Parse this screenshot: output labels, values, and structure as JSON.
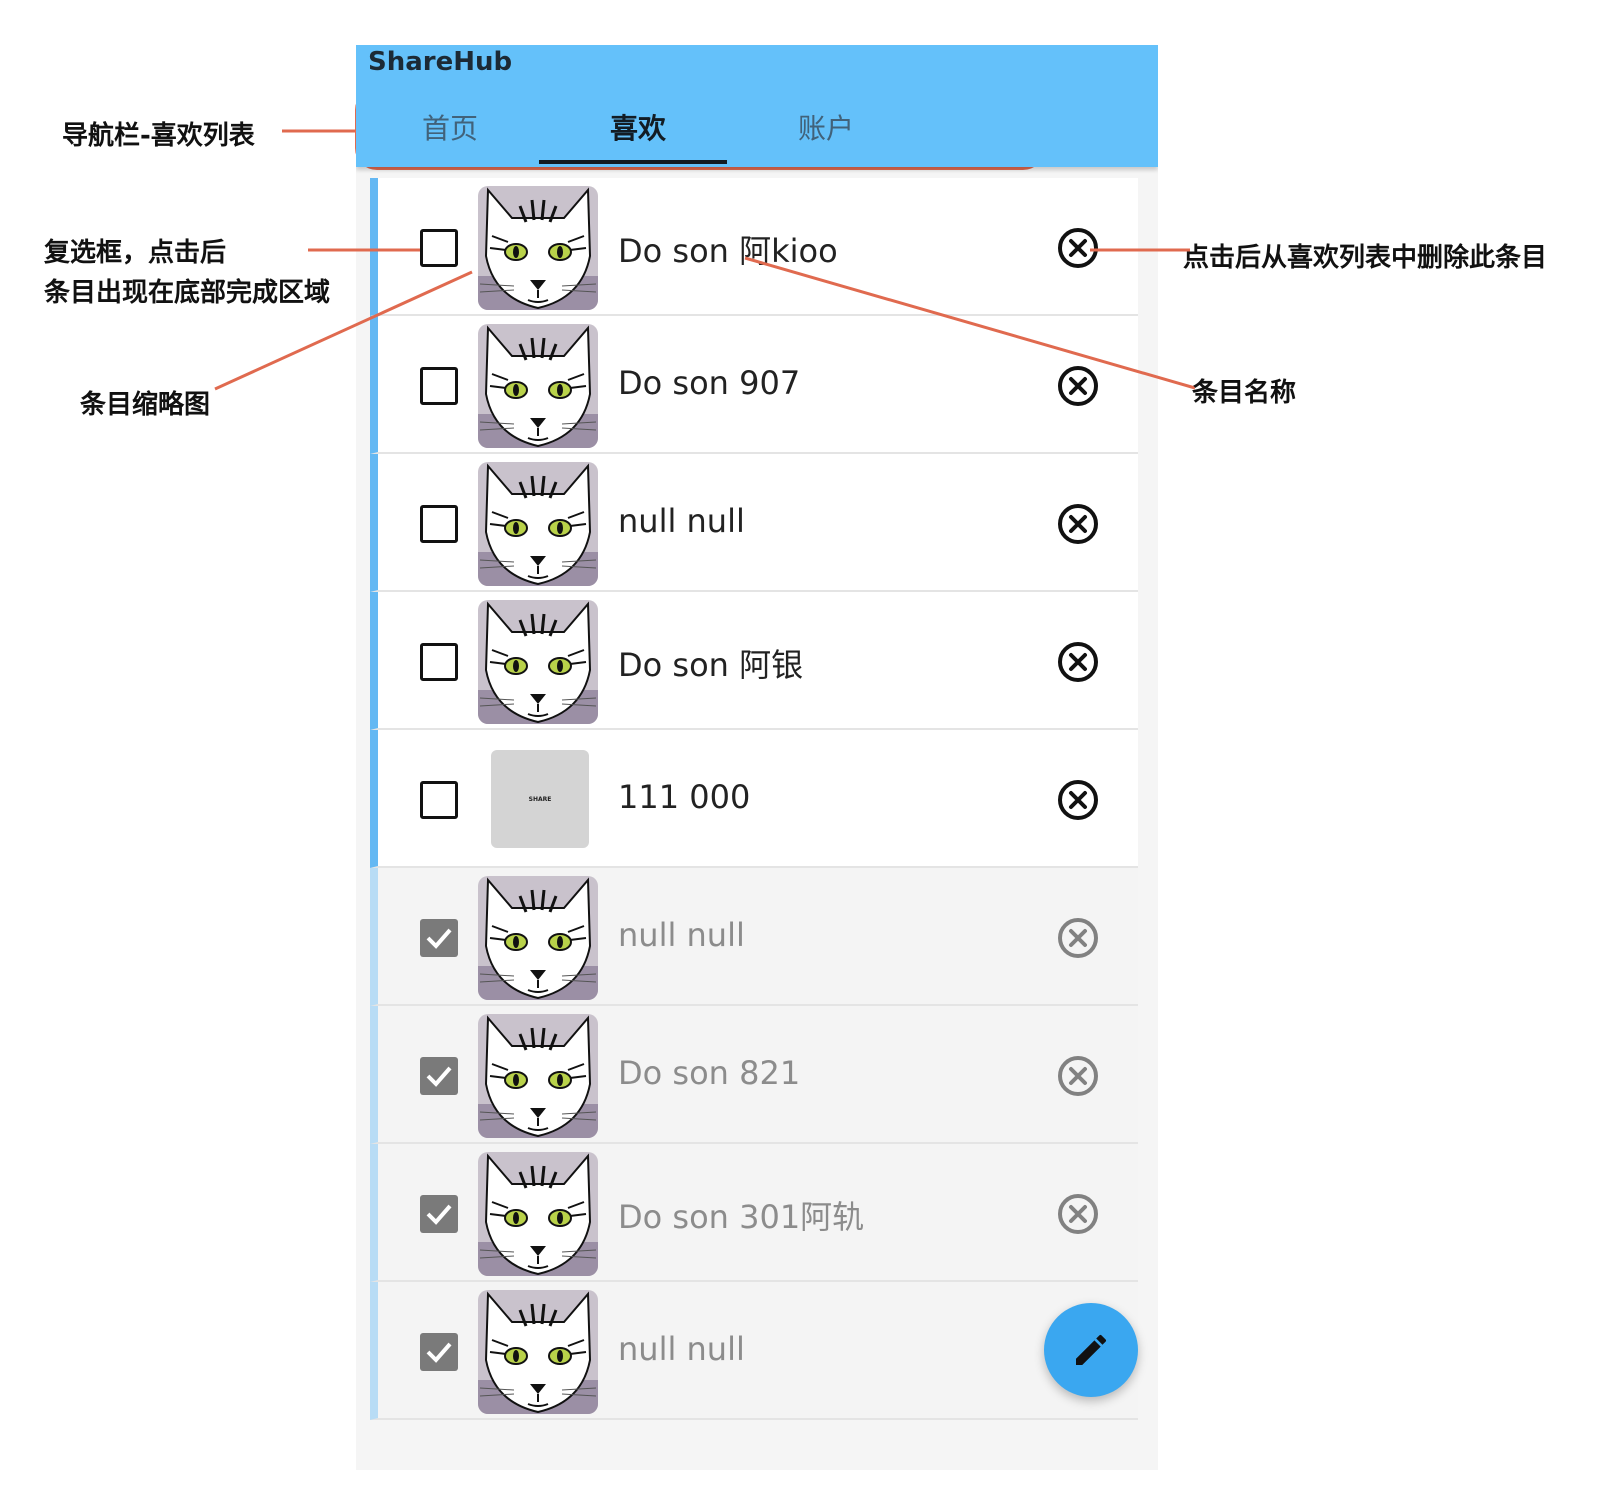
{
  "app": {
    "title": "ShareHub"
  },
  "tabs": [
    {
      "label": "首页",
      "active": false
    },
    {
      "label": "喜欢",
      "active": true
    },
    {
      "label": "账户",
      "active": false
    }
  ],
  "items": [
    {
      "title": "Do son 阿kioo",
      "checked": false,
      "thumb": "cat-avatar"
    },
    {
      "title": "Do son 907",
      "checked": false,
      "thumb": "cat-avatar"
    },
    {
      "title": "null null",
      "checked": false,
      "thumb": "cat-avatar"
    },
    {
      "title": "Do son 阿银",
      "checked": false,
      "thumb": "cat-avatar"
    },
    {
      "title": "111 000",
      "checked": false,
      "thumb": "share-placeholder",
      "thumb_text": "SHARE"
    },
    {
      "title": "null null",
      "checked": true,
      "thumb": "cat-avatar"
    },
    {
      "title": "Do son 821",
      "checked": true,
      "thumb": "cat-avatar"
    },
    {
      "title": "Do son 301阿轨",
      "checked": true,
      "thumb": "cat-avatar"
    },
    {
      "title": "null null",
      "checked": true,
      "thumb": "cat-avatar"
    }
  ],
  "fab": {
    "icon": "pencil-icon"
  },
  "annotations": {
    "navbar": "导航栏-喜欢列表",
    "checkbox_line1": "复选框，点击后",
    "checkbox_line2": "条目出现在底部完成区域",
    "thumbnail": "条目缩略图",
    "delete": "点击后从喜欢列表中删除此条目",
    "item_name": "条目名称"
  },
  "colors": {
    "appbar": "#64c1fa",
    "accent_bar": "#64b8f3",
    "fab": "#3aa7f0",
    "annotation_line": "#e06a4f"
  }
}
